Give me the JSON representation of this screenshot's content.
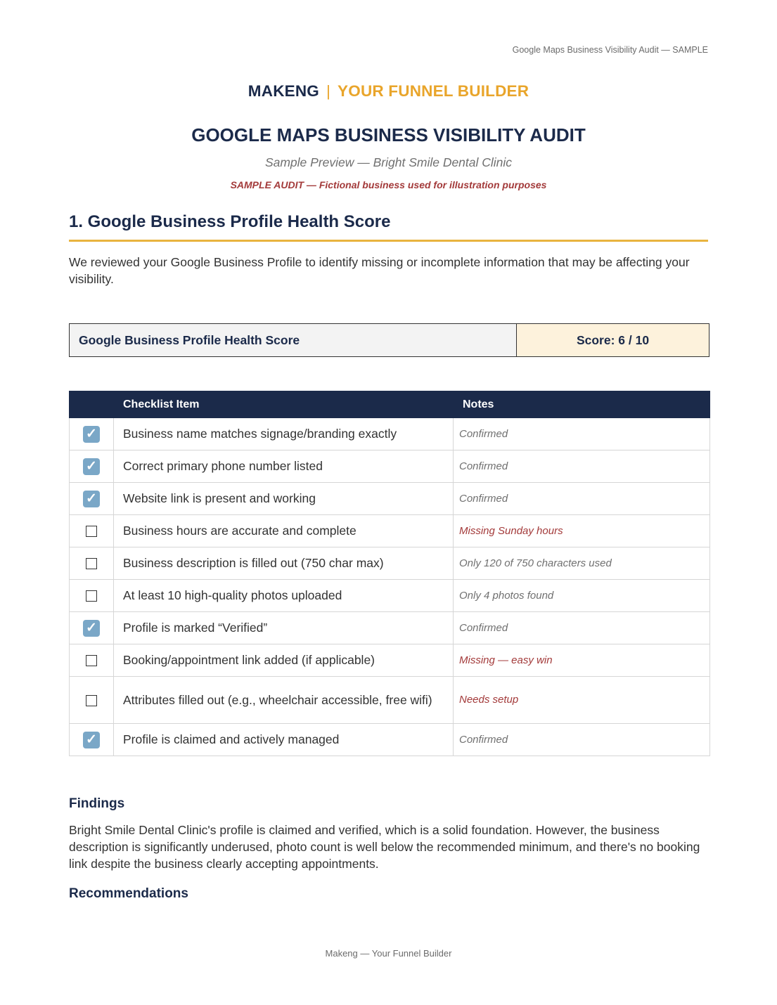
{
  "header": {
    "running": "Google Maps Business Visibility Audit — SAMPLE"
  },
  "brand": {
    "name": "MAKENG",
    "separator": "|",
    "tagline": "YOUR FUNNEL BUILDER"
  },
  "title": "GOOGLE MAPS BUSINESS VISIBILITY AUDIT",
  "subtitle": "Sample Preview — Bright Smile Dental Clinic",
  "sample_note": "SAMPLE AUDIT — Fictional business used for illustration purposes",
  "section": {
    "heading": "1. Google Business Profile Health Score",
    "intro": "We reviewed your Google Business Profile to identify missing or incomplete information that may be affecting your visibility."
  },
  "score_box": {
    "label": "Google Business Profile Health Score",
    "score": "Score:  6 / 10"
  },
  "checklist": {
    "headers": {
      "check": "",
      "item": "Checklist Item",
      "notes": "Notes"
    },
    "check_glyph": "✓",
    "rows": [
      {
        "checked": true,
        "item": "Business name matches signage/branding exactly",
        "note": "Confirmed",
        "alert": false
      },
      {
        "checked": true,
        "item": "Correct primary phone number listed",
        "note": "Confirmed",
        "alert": false
      },
      {
        "checked": true,
        "item": "Website link is present and working",
        "note": "Confirmed",
        "alert": false
      },
      {
        "checked": false,
        "item": "Business hours are accurate and complete",
        "note": "Missing Sunday hours",
        "alert": true
      },
      {
        "checked": false,
        "item": "Business description is filled out (750 char max)",
        "note": "Only 120 of 750 characters used",
        "alert": false
      },
      {
        "checked": false,
        "item": "At least 10 high-quality photos uploaded",
        "note": "Only 4 photos found",
        "alert": false
      },
      {
        "checked": true,
        "item": "Profile is marked “Verified”",
        "note": "Confirmed",
        "alert": false
      },
      {
        "checked": false,
        "item": "Booking/appointment link added (if applicable)",
        "note": "Missing — easy win",
        "alert": true
      },
      {
        "checked": false,
        "item": "Attributes filled out (e.g., wheelchair accessible, free wifi)",
        "note": "Needs setup",
        "alert": true
      },
      {
        "checked": true,
        "item": "Profile is claimed and actively managed",
        "note": "Confirmed",
        "alert": false
      }
    ]
  },
  "findings": {
    "heading": "Findings",
    "text": "Bright Smile Dental Clinic's profile is claimed and verified, which is a solid foundation. However, the business description is significantly underused, photo count is well below the recommended minimum, and there's no booking link despite the business clearly accepting appointments."
  },
  "recommendations": {
    "heading": "Recommendations"
  },
  "footer": {
    "text": "Makeng — Your Funnel Builder"
  },
  "colors": {
    "navy": "#1b2a4a",
    "gold": "#e9a52b",
    "alert_red": "#a33a3a",
    "check_blue": "#7aa7c7"
  }
}
